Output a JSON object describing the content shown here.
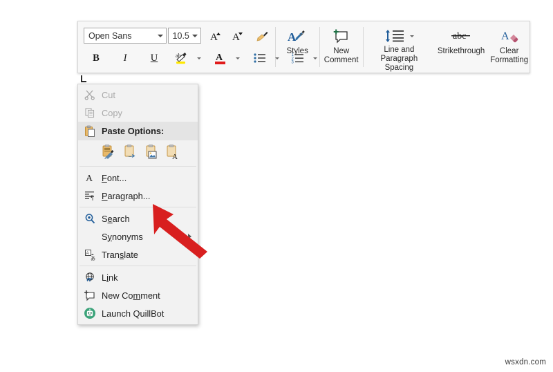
{
  "toolbar": {
    "font_name": "Open Sans",
    "font_size": "10.5",
    "grow_font_label": "A",
    "shrink_font_label": "A",
    "format_painter_label": "",
    "bold_label": "B",
    "italic_label": "I",
    "underline_label": "U",
    "highlight_label": "ab",
    "font_color_label": "A",
    "bullets_label": "",
    "numbering_label": "",
    "styles_label": "Styles",
    "new_comment_label": "New\nComment",
    "new_comment_line1": "New",
    "new_comment_line2": "Comment",
    "line_spacing_line1": "Line and Paragraph",
    "line_spacing_line2": "Spacing",
    "strikethrough_label": "Strikethrough",
    "strikethrough_icon_text": "abc",
    "clear_formatting_line1": "Clear",
    "clear_formatting_line2": "Formatting"
  },
  "context_menu": {
    "items": [
      {
        "id": "cut",
        "label": "Cut",
        "icon": "scissors-icon",
        "disabled": true,
        "submenu": false
      },
      {
        "id": "copy",
        "label": "Copy",
        "icon": "copy-icon",
        "disabled": true,
        "submenu": false
      },
      {
        "id": "paste",
        "label": "Paste Options:",
        "icon": "clipboard-icon",
        "disabled": false,
        "submenu": false,
        "header": true
      },
      {
        "id": "font",
        "label": "Font...",
        "icon": "font-a-icon",
        "disabled": false,
        "submenu": false
      },
      {
        "id": "paragraph",
        "label": "Paragraph...",
        "icon": "paragraph-icon",
        "disabled": false,
        "submenu": false
      },
      {
        "id": "search",
        "label": "Search",
        "icon": "search-icon",
        "disabled": false,
        "submenu": false
      },
      {
        "id": "synonyms",
        "label": "Synonyms",
        "icon": "none",
        "disabled": false,
        "submenu": true
      },
      {
        "id": "translate",
        "label": "Translate",
        "icon": "translate-icon",
        "disabled": false,
        "submenu": false
      },
      {
        "id": "link",
        "label": "Link",
        "icon": "globe-link-icon",
        "disabled": false,
        "submenu": false
      },
      {
        "id": "newcomment",
        "label": "New Comment",
        "icon": "comment-icon",
        "disabled": false,
        "submenu": false
      },
      {
        "id": "quillbot",
        "label": "Launch QuillBot",
        "icon": "quillbot-icon",
        "disabled": false,
        "submenu": false
      }
    ],
    "paste_options": [
      {
        "id": "keep-source-formatting",
        "name": "paste-keep-source-formatting"
      },
      {
        "id": "merge-formatting",
        "name": "paste-merge-formatting"
      },
      {
        "id": "picture",
        "name": "paste-picture"
      },
      {
        "id": "keep-text-only",
        "name": "paste-keep-text-only"
      }
    ]
  },
  "annotation": {
    "arrow_color": "#d81f1f",
    "arrow_target": "Paragraph..."
  },
  "watermark": {
    "text": "wsxdn.com"
  },
  "document": {
    "paragraph_mark": "⌐"
  }
}
